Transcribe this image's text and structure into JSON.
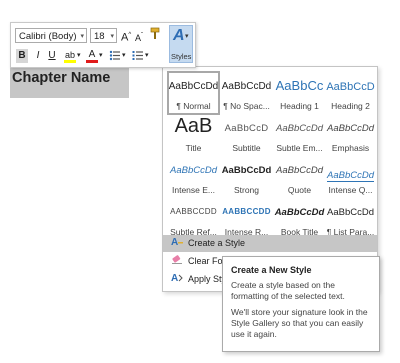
{
  "mini_toolbar": {
    "font_name": "Calibri (Body)",
    "font_size": "18",
    "grow_font": "A",
    "shrink_font": "A",
    "bold": "B",
    "italic": "I",
    "underline": "U",
    "highlight": "ab",
    "font_color": "A",
    "styles_glyph": "A",
    "styles_label": "Styles",
    "dropdown_glyph": "▾",
    "accent_color": "#2e74b5",
    "highlight_color": "#ffff00",
    "font_color_bar": "#e01b1b"
  },
  "document": {
    "heading": "Chapter Name"
  },
  "styles_gallery": {
    "tiles": [
      {
        "preview": "AaBbCcDd",
        "caption": "¶ Normal"
      },
      {
        "preview": "AaBbCcDd",
        "caption": "¶ No Spac..."
      },
      {
        "preview": "AaBbCc",
        "caption": "Heading 1"
      },
      {
        "preview": "AaBbCcD",
        "caption": "Heading 2"
      },
      {
        "preview": "AaB",
        "caption": "Title"
      },
      {
        "preview": "AaBbCcD",
        "caption": "Subtitle"
      },
      {
        "preview": "AaBbCcDd",
        "caption": "Subtle Em..."
      },
      {
        "preview": "AaBbCcDd",
        "caption": "Emphasis"
      },
      {
        "preview": "AaBbCcDd",
        "caption": "Intense E..."
      },
      {
        "preview": "AaBbCcDd",
        "caption": "Strong"
      },
      {
        "preview": "AaBbCcDd",
        "caption": "Quote"
      },
      {
        "preview": "AaBbCcDd",
        "caption": "Intense Q..."
      },
      {
        "preview": "AaBbCcDd",
        "caption": "Subtle Ref..."
      },
      {
        "preview": "AaBbCcDd",
        "caption": "Intense R..."
      },
      {
        "preview": "AaBbCcDd",
        "caption": "Book Title"
      },
      {
        "preview": "AaBbCcDd",
        "caption": "¶ List Para..."
      }
    ],
    "menu": [
      {
        "icon": "create-style-icon",
        "label": "Create a Style"
      },
      {
        "icon": "clear-formatting-icon",
        "label": "Clear Form..."
      },
      {
        "icon": "apply-styles-icon",
        "label": "Apply Sty..."
      }
    ]
  },
  "tooltip": {
    "title": "Create a New Style",
    "line1": "Create a style based on the formatting of the selected text.",
    "line2": "We'll store your signature look in the Style Gallery so that you can easily use it again."
  }
}
